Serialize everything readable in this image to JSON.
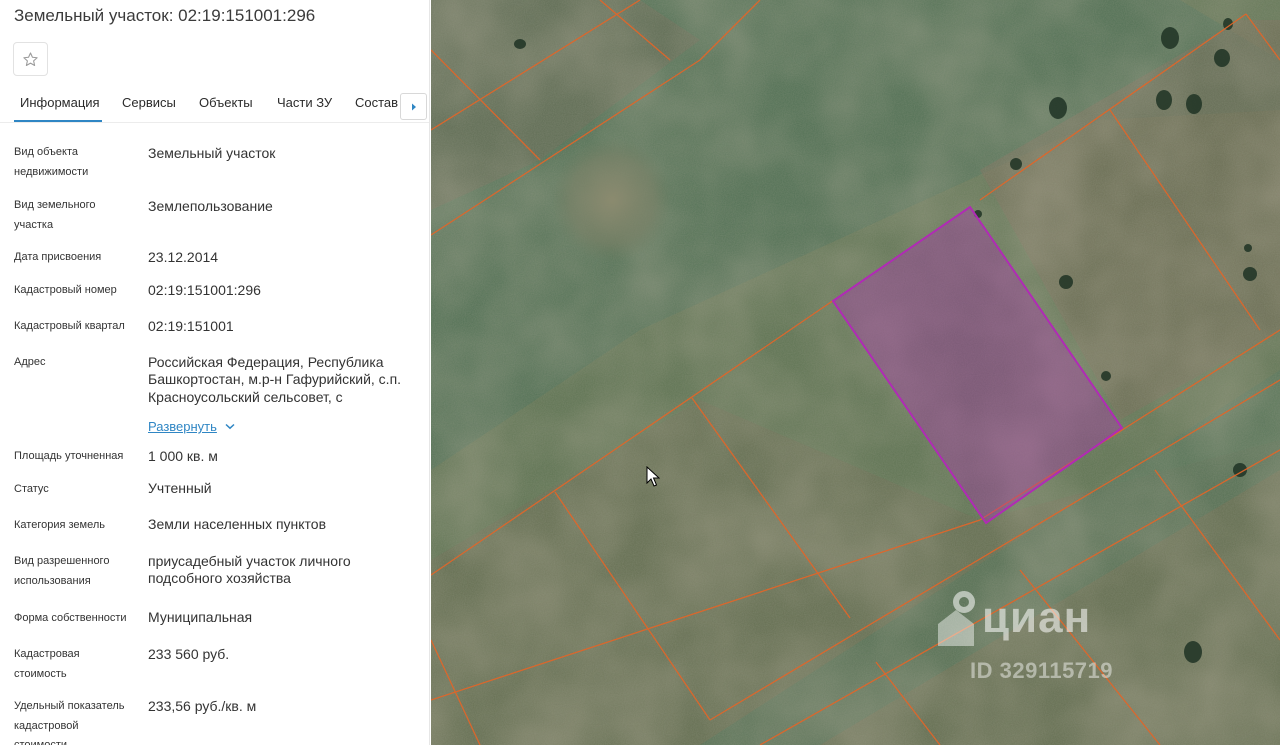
{
  "panel": {
    "title": "Земельный участок: 02:19:151001:296",
    "favorite_icon": "star-outline-icon",
    "tabs": [
      {
        "label": "Информация",
        "active": true
      },
      {
        "label": "Сервисы",
        "active": false
      },
      {
        "label": "Объекты",
        "active": false
      },
      {
        "label": "Части ЗУ",
        "active": false
      },
      {
        "label": "Состав",
        "active": false
      }
    ],
    "tabs_next_icon": "caret-right-icon",
    "accent_color": "#2f86c4",
    "fields": [
      {
        "label": "Вид объекта недвижимости",
        "value": "Земельный участок"
      },
      {
        "label": "Вид земельного участка",
        "value": "Землепользование"
      },
      {
        "label": "Дата присвоения",
        "value": "23.12.2014"
      },
      {
        "label": "Кадастровый номер",
        "value": "02:19:151001:296"
      },
      {
        "label": "Кадастровый квартал",
        "value": "02:19:151001"
      },
      {
        "label": "Адрес",
        "value": "Российская Федерация, Республика Башкортостан, м.р-н Гафурийский, с.п. Красноусольский сельсовет, с",
        "expand_label": "Развернуть"
      },
      {
        "label": "Площадь уточненная",
        "value": "1 000 кв. м"
      },
      {
        "label": "Статус",
        "value": "Учтенный"
      },
      {
        "label": "Категория земель",
        "value": "Земли населенных пунктов"
      },
      {
        "label": "Вид разрешенного использования",
        "value": "приусадебный участок личного подсобного хозяйства"
      },
      {
        "label": "Форма собственности",
        "value": "Муниципальная"
      },
      {
        "label": "Кадастровая стоимость",
        "value": "233 560 руб."
      },
      {
        "label": "Удельный показатель кадастровой стоимости",
        "value": "233,56 руб./кв. м"
      }
    ]
  },
  "map": {
    "parcel_boundary_color": "#e0662a",
    "selected_parcel_color": "#b02bb5",
    "watermark_logo": "циан",
    "watermark_id": "ID 329115719",
    "watermark_icon": "cian-house-icon"
  }
}
